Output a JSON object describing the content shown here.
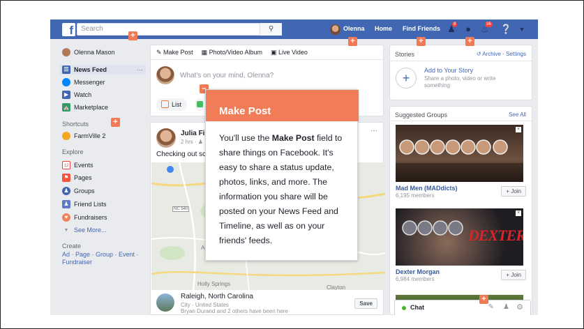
{
  "topbar": {
    "search_placeholder": "Search",
    "user_name": "Olenna",
    "home": "Home",
    "find_friends": "Find Friends",
    "friend_badge": "8",
    "notif_badge": "36"
  },
  "leftnav": {
    "profile_name": "Olenna Mason",
    "items": [
      "News Feed",
      "Messenger",
      "Watch",
      "Marketplace"
    ],
    "more_dots": "···",
    "shortcuts_label": "Shortcuts",
    "shortcut": "FarmVille 2",
    "explore_label": "Explore",
    "explore_items": [
      "Events",
      "Pages",
      "Groups",
      "Friend Lists",
      "Fundraisers"
    ],
    "see_more": "See More...",
    "create_label": "Create",
    "create_links": "Ad · Page · Group · Event ·",
    "create_links2": "Fundraiser",
    "events_icon_num": "12"
  },
  "composer": {
    "tab_make_post": "Make Post",
    "tab_photo": "Photo/Video Album",
    "tab_live": "Live Video",
    "placeholder": "What's on your mind, Olenna?",
    "pill_list": "List"
  },
  "post": {
    "author": "Julia Fill",
    "meta": "2 hrs ·",
    "text": "Checking out sc",
    "more": "···",
    "place_name": "Raleigh, North Carolina",
    "place_sub": "City · United States",
    "place_friends": "Bryan Durand and 2 others have been here",
    "save": "Save",
    "map_labels": [
      "Apex",
      "Holly Springs",
      "Clayton",
      "NC 540"
    ]
  },
  "popup": {
    "title": "Make Post",
    "body_pre": "You'll use the ",
    "body_bold": "Make Post",
    "body_post": " field to share things on Facebook. It's easy to share a status update, photos, links, and more. The information you share will be posted on your News Feed and Timeline, as well as on your friends' feeds."
  },
  "stories": {
    "title": "Stories",
    "archive": "Archive",
    "settings": "Settings",
    "add_title": "Add to Your Story",
    "add_sub": "Share a photo, video or write something"
  },
  "groups": {
    "title": "Suggested Groups",
    "see_all": "See All",
    "items": [
      {
        "name": "Mad Men (MADdicts)",
        "members": "6,195 members",
        "join": "+ Join"
      },
      {
        "name": "Dexter Morgan",
        "members": "6,984 members",
        "join": "+ Join",
        "banner": "DEXTER"
      }
    ]
  },
  "chat": {
    "label": "Chat"
  },
  "plus_marker": "+",
  "colors": {
    "fb_blue": "#4267b2",
    "accent": "#f17d58"
  }
}
